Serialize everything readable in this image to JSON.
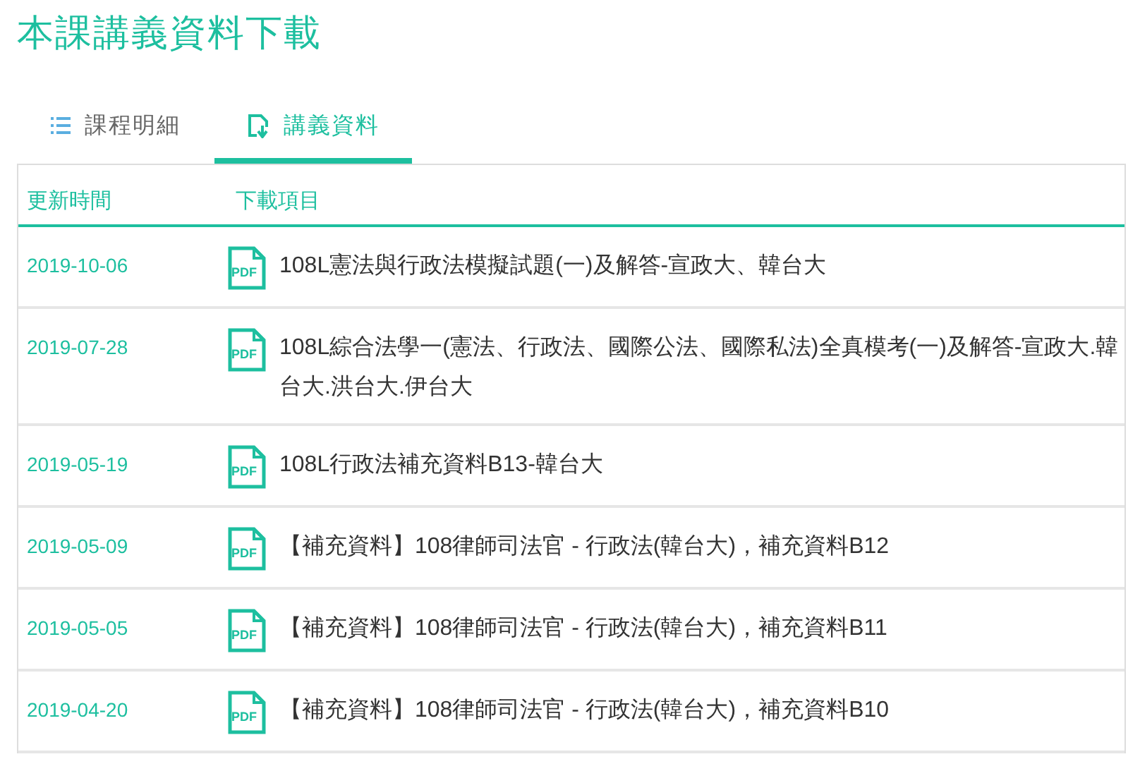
{
  "title": "本課講義資料下載",
  "tabs": [
    {
      "label": "課程明細",
      "kind": "list",
      "selected": false
    },
    {
      "label": "講義資料",
      "kind": "download",
      "selected": true
    }
  ],
  "table": {
    "columns": [
      "更新時間",
      "下載項目"
    ],
    "rows": [
      {
        "date": "2019-10-06",
        "file_type": "PDF",
        "name": "108L憲法與行政法模擬試題(一)及解答-宣政大、韓台大"
      },
      {
        "date": "2019-07-28",
        "file_type": "PDF",
        "name": "108L綜合法學一(憲法、行政法、國際公法、國際私法)全真模考(一)及解答-宣政大.韓台大.洪台大.伊台大"
      },
      {
        "date": "2019-05-19",
        "file_type": "PDF",
        "name": "108L行政法補充資料B13-韓台大"
      },
      {
        "date": "2019-05-09",
        "file_type": "PDF",
        "name": "【補充資料】108律師司法官 - 行政法(韓台大)，補充資料B12"
      },
      {
        "date": "2019-05-05",
        "file_type": "PDF",
        "name": "【補充資料】108律師司法官 - 行政法(韓台大)，補充資料B11"
      },
      {
        "date": "2019-04-20",
        "file_type": "PDF",
        "name": "【補充資料】108律師司法官 - 行政法(韓台大)，補充資料B10"
      }
    ]
  }
}
